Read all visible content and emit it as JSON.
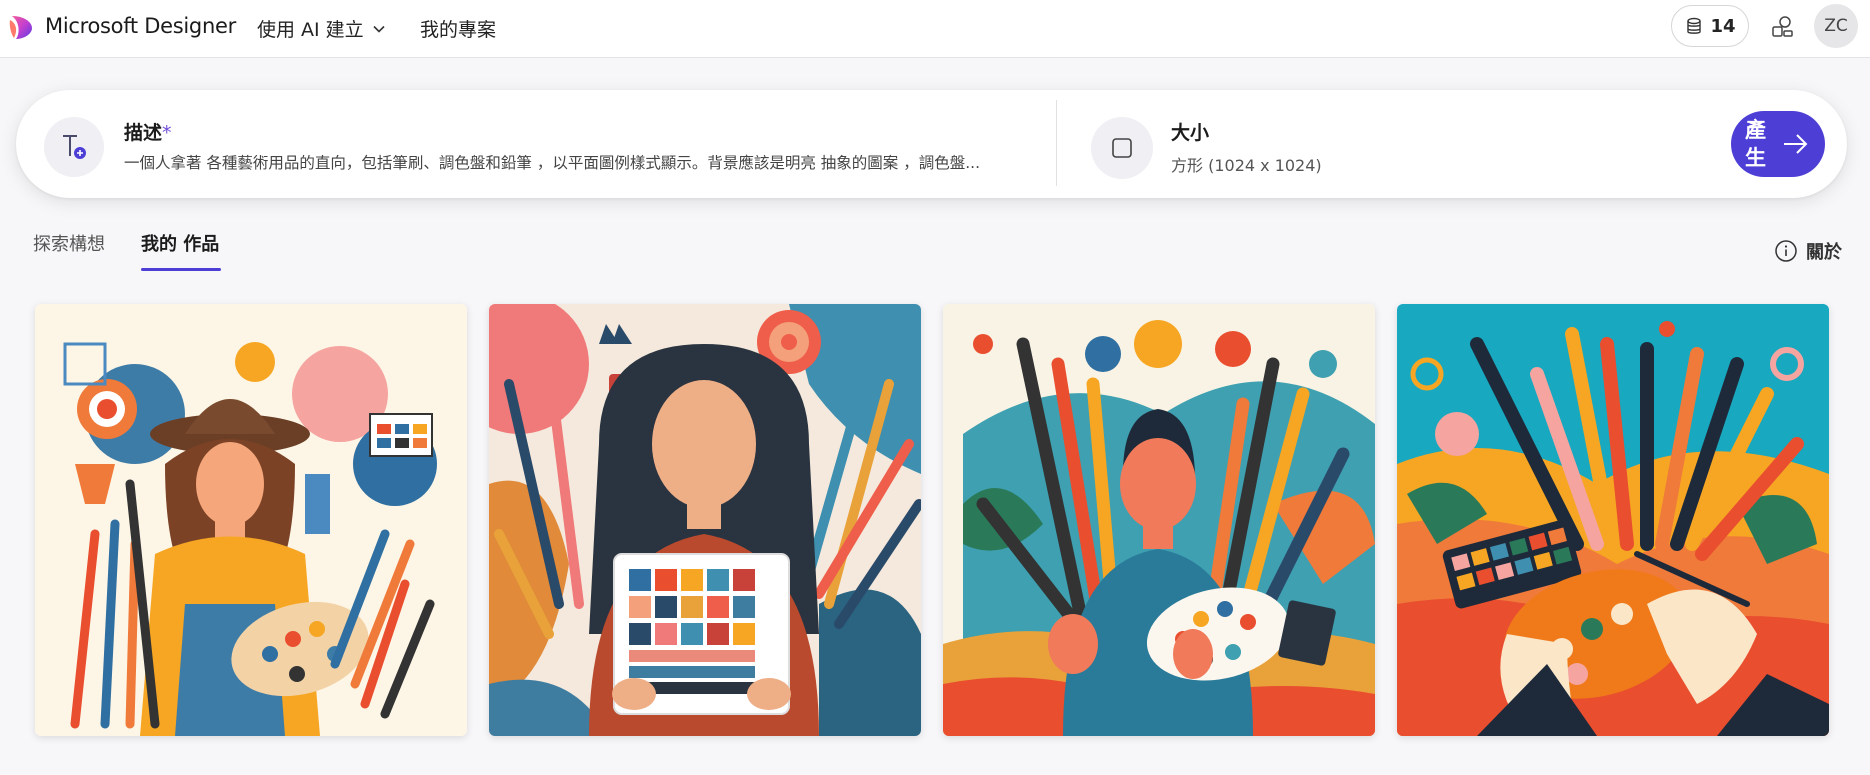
{
  "header": {
    "brand": "Microsoft Designer",
    "nav_create": "使用 AI 建立",
    "nav_projects": "我的專案",
    "credits": "14",
    "avatar_initials": "ZC"
  },
  "prompt": {
    "title": "描述",
    "required_mark": "*",
    "text": "一個人拿著 各種藝術用品的直向，包括筆刷、調色盤和鉛筆 ，以平面圖例樣式顯示。背景應該是明亮 抽象的圖案 ，調色盤...",
    "size_title": "大小",
    "size_value": "方形 (1024 x 1024)",
    "generate_label": "產生"
  },
  "tabs": {
    "explore": "探索構想",
    "mine": "我的 作品"
  },
  "about_label": "關於",
  "colors": {
    "accent": "#4d3fd6",
    "required": "#6f4cd8"
  },
  "images": [
    {
      "name": "woman-with-hat-palette"
    },
    {
      "name": "girl-holding-color-chart"
    },
    {
      "name": "man-with-brushes-palette"
    },
    {
      "name": "hands-with-palette"
    }
  ]
}
